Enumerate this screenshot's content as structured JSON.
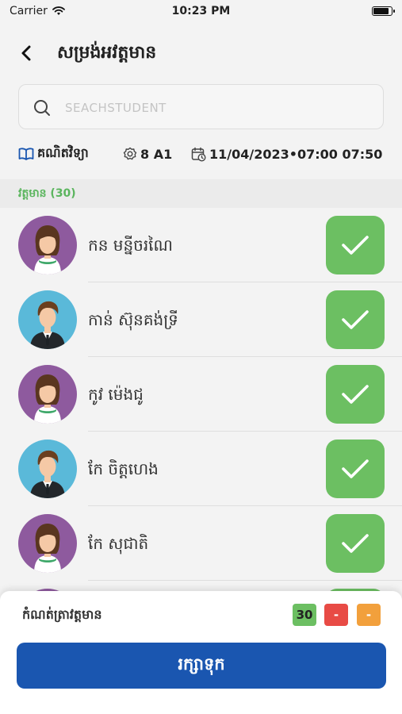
{
  "status_bar": {
    "carrier": "Carrier",
    "time": "10:23 PM",
    "battery_level": 0.9
  },
  "header": {
    "title": "សម្រង់អវត្តមាន",
    "back_icon": "chevron-left-icon"
  },
  "search": {
    "placeholder": "SEACHSTUDENT",
    "value": ""
  },
  "info": {
    "subject": "គណិតវិទ្យា",
    "class": "8 A1",
    "datetime": "11/04/2023•07:00 07:50"
  },
  "section": {
    "label": "វត្តមាន (30)"
  },
  "students": [
    {
      "name": "កន មន្នីចរណៃ",
      "gender": "female",
      "present": true
    },
    {
      "name": "កាន់ ស៊ុនគង់ទ្រី",
      "gender": "male",
      "present": true
    },
    {
      "name": "កូវ ម៉េងជូ",
      "gender": "female",
      "present": true
    },
    {
      "name": "កែ ចិត្តហេង",
      "gender": "male",
      "present": true
    },
    {
      "name": "កែ សុជាតិ",
      "gender": "female",
      "present": true
    },
    {
      "name": "",
      "gender": "female",
      "present": true
    }
  ],
  "footer": {
    "label": "កំណត់ត្រាវត្តមាន",
    "present_count": "30",
    "absent_count": "-",
    "permission_count": "-",
    "save_label": "រក្សាទុក"
  },
  "colors": {
    "present_green": "#6cbf62",
    "absent_red": "#e84b45",
    "permission_orange": "#f2a03c",
    "primary_blue": "#1a56b0",
    "female_avatar_bg": "#8e5a9e",
    "male_avatar_bg": "#5ab9d9"
  }
}
